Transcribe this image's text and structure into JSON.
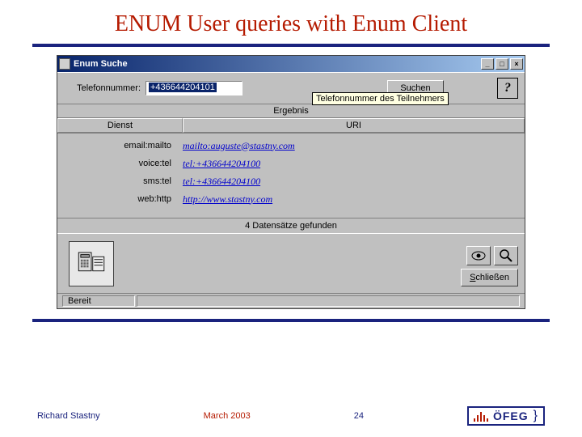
{
  "slide": {
    "title": "ENUM User queries with Enum Client"
  },
  "window": {
    "title": "Enum Suche",
    "controls": {
      "min": "_",
      "max": "□",
      "close": "×"
    }
  },
  "toolbar": {
    "phone_label": "Telefonnummer:",
    "phone_value": "+436644204101",
    "search_label": "Suchen",
    "tooltip": "Telefonnummer des Teilnehmers",
    "help_glyph": "?"
  },
  "results": {
    "section_label": "Ergebnis",
    "headers": {
      "dienst": "Dienst",
      "uri": "URI"
    },
    "rows": [
      {
        "service": "email:mailto",
        "uri": "mailto:auguste@stastny.com"
      },
      {
        "service": "voice:tel",
        "uri": "tel:+436644204100"
      },
      {
        "service": "sms:tel",
        "uri": "tel:+436644204100"
      },
      {
        "service": "web:http",
        "uri": "http://www.stastny.com"
      }
    ],
    "count_text": "4 Datensätze gefunden"
  },
  "buttons": {
    "close_prefix": "S",
    "close_rest": "chließen"
  },
  "status": {
    "ready": "Bereit"
  },
  "footer": {
    "author": "Richard Stastny",
    "date": "March 2003",
    "page_number": "24",
    "logo_text": "ÖFEG"
  }
}
